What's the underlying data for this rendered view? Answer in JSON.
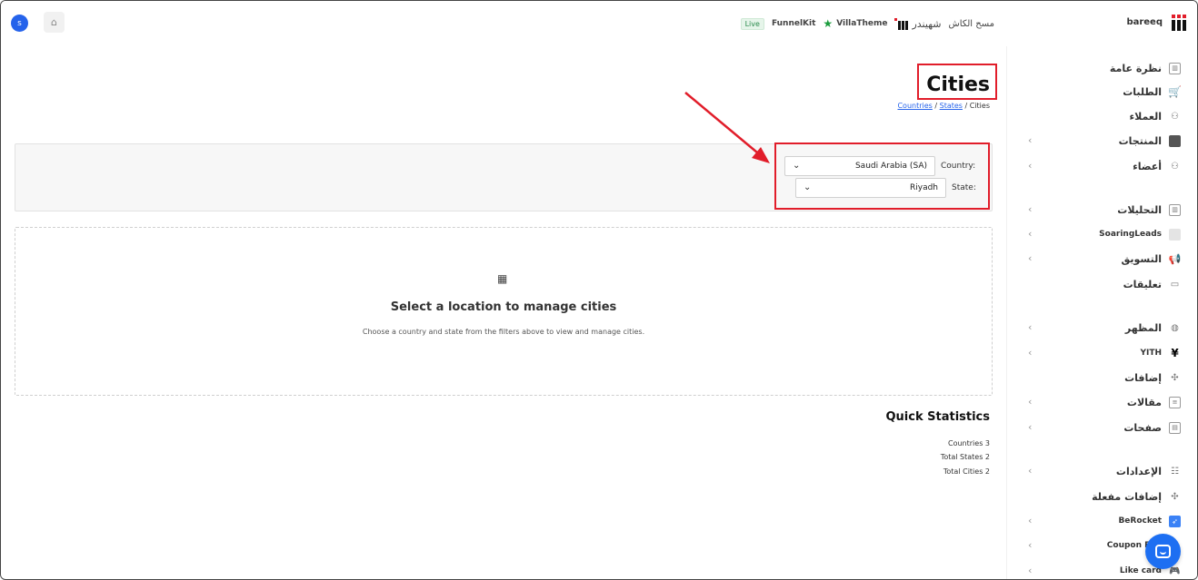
{
  "topbar": {
    "avatar_letter": "s",
    "home_icon": "home-icon",
    "links": {
      "cash_clear": "مسح الكاش",
      "shahinder": "شهيندر",
      "villatheme": "VillaTheme",
      "funnelkit": "FunnelKit",
      "live": "Live"
    },
    "site_name": "bareeq",
    "accent_star": "#1a9c3c"
  },
  "sidebar": {
    "items": [
      {
        "label": "نظرة عامة",
        "icon": "overview-icon"
      },
      {
        "label": "الطلبات",
        "icon": "cart-icon"
      },
      {
        "label": "العملاء",
        "icon": "customers-icon"
      },
      {
        "label": "المنتجات",
        "icon": "products-icon"
      },
      {
        "label": "أعضاء",
        "icon": "members-icon"
      },
      {
        "label": "التحليلات",
        "icon": "analytics-icon"
      },
      {
        "label": "SoaringLeads",
        "icon": "soaringleads-icon"
      },
      {
        "label": "التسويق",
        "icon": "marketing-icon"
      },
      {
        "label": "تعليقات",
        "icon": "comments-icon"
      },
      {
        "label": "المظهر",
        "icon": "appearance-icon"
      },
      {
        "label": "YITH",
        "icon": "yith-icon"
      },
      {
        "label": "إضافات",
        "icon": "plugins-icon"
      },
      {
        "label": "مقالات",
        "icon": "posts-icon"
      },
      {
        "label": "صفحات",
        "icon": "pages-icon"
      },
      {
        "label": "الإعدادات",
        "icon": "settings-icon"
      },
      {
        "label": "إضافات مفعلة",
        "icon": "active-plugins-icon"
      },
      {
        "label": "BeRocket",
        "icon": "berocket-icon"
      },
      {
        "label": "Coupon Box",
        "icon": "coupon-icon"
      },
      {
        "label": "Like card",
        "icon": "likecard-icon"
      }
    ]
  },
  "main": {
    "title": "Cities",
    "breadcrumb": {
      "countries": "Countries",
      "sep1": " / ",
      "states": "States",
      "sep2": " / ",
      "current": "Cities"
    },
    "filters": {
      "country_label": "Country:",
      "country_value": "Saudi Arabia (SA)",
      "state_label": "State:",
      "state_value": "Riyadh"
    },
    "empty_state": {
      "icon": "building-icon",
      "title": "Select a location to manage cities",
      "subtitle": "Choose a country and state from the filters above to view and manage cities."
    },
    "stats": {
      "title": "Quick Statistics",
      "countries": "Countries 3",
      "total_states": "Total States 2",
      "total_cities": "Total Cities 2"
    }
  },
  "colors": {
    "annotation_red": "#e11d2a",
    "link_blue": "#2563eb",
    "chat_blue": "#1d6ff2"
  }
}
